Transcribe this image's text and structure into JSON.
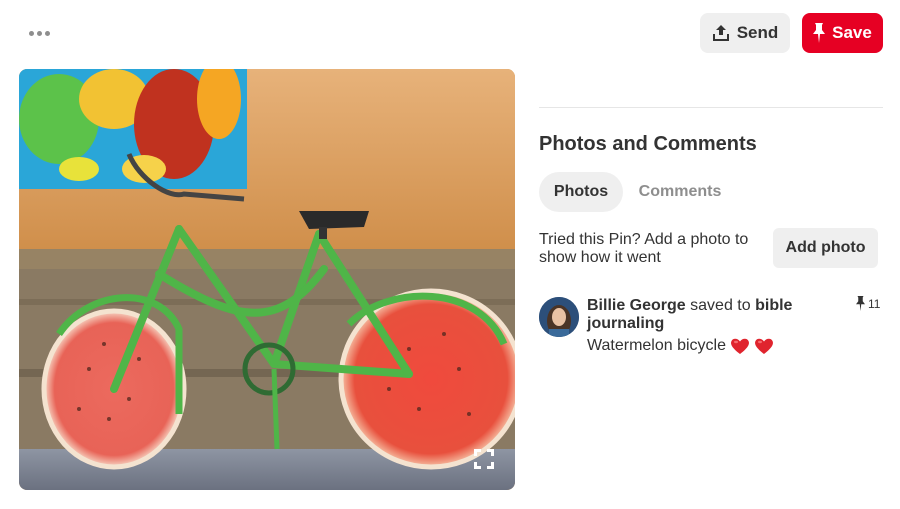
{
  "toolbar": {
    "more_icon": "more-horizontal-icon",
    "send_label": "Send",
    "send_icon": "share-upload-icon",
    "save_label": "Save",
    "save_icon": "pin-icon",
    "save_color": "#e60023"
  },
  "pin": {
    "image_icon": "expand-icon"
  },
  "panel": {
    "title": "Photos and Comments",
    "tabs": [
      {
        "label": "Photos",
        "active": true
      },
      {
        "label": "Comments",
        "active": false
      }
    ],
    "tried_prompt": "Tried this Pin? Add a photo to show how it went",
    "add_photo_label": "Add photo"
  },
  "activity": {
    "user": "Billie George",
    "verb": "saved to",
    "board": "bible journaling",
    "caption": "Watermelon bicycle",
    "caption_emoji": "heart-emoji x2",
    "repin_count": "11",
    "repin_icon": "pin-icon"
  }
}
